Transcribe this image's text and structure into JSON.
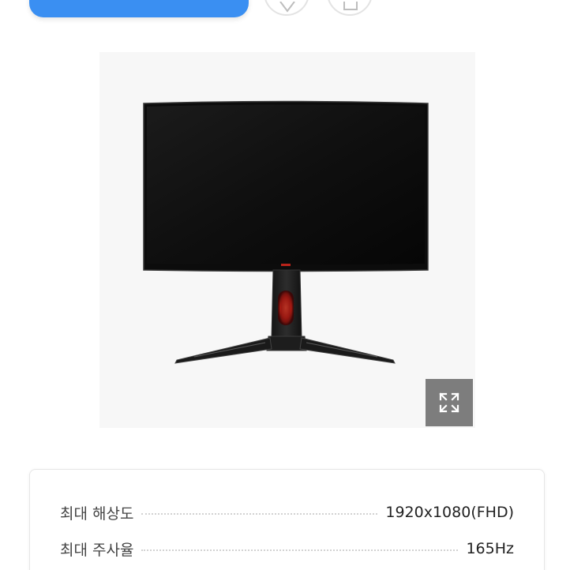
{
  "action_bar": {
    "buy_label": "• • • • • • • •",
    "wish_icon": "heart-icon",
    "share_icon": "share-icon",
    "accent_color": "#3a8ff2"
  },
  "product": {
    "image_icon": "curved-gaming-monitor-image",
    "expand_icon": "expand-icon"
  },
  "specs": [
    {
      "label": "최대 해상도",
      "value": "1920x1080(FHD)"
    },
    {
      "label": "최대 주사율",
      "value": "165Hz"
    }
  ]
}
